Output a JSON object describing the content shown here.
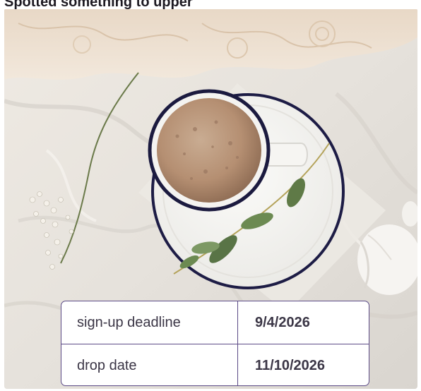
{
  "header": {
    "title": "Spotted something to upper"
  },
  "photo": {
    "subject": "coffee-cup-on-saucer-icon"
  },
  "schedule": {
    "rows": [
      {
        "label": "sign-up deadline",
        "value": "9/4/2026"
      },
      {
        "label": "drop date",
        "value": "11/10/2026"
      }
    ]
  },
  "colors": {
    "table_border": "#5b4a86",
    "text": "#3b3646"
  }
}
